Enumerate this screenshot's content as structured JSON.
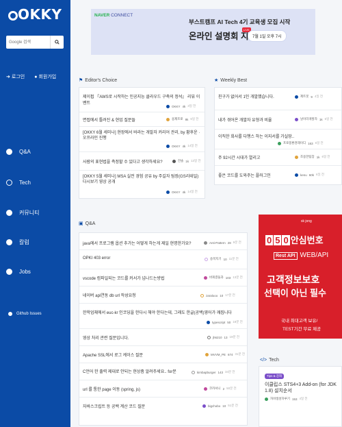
{
  "sidebar": {
    "logo": "OKKY",
    "search_placeholder": "Google 검색",
    "login": "로그인",
    "signup": "회원가입",
    "nav": [
      {
        "label": "Q&A",
        "icon": "qa-icon"
      },
      {
        "label": "Tech",
        "icon": "code-icon"
      },
      {
        "label": "커뮤니티",
        "icon": "community-icon"
      },
      {
        "label": "칼럼",
        "icon": "column-icon"
      },
      {
        "label": "Jobs",
        "icon": "jobs-icon"
      }
    ],
    "github": "Github Issues"
  },
  "banner": {
    "brand_prefix": "NAVER",
    "brand_suffix": " CONNECT",
    "line1": "부스트캠프 AI Tech 4기 교육생 모집 시작",
    "line2": "온라인 설명회 지금 신청!",
    "live": "LIVE",
    "date": "7월 1일 오후 7시"
  },
  "editors_choice": {
    "title": "Editor's Choice",
    "items": [
      {
        "title": "제이펍 『AWS로 시작하는 인공지능 클라우드 구축의 정석』 리뷰 이벤트",
        "author": "OKKY",
        "score": "4k",
        "time": "3일 전"
      },
      {
        "title": "면접에서 틀려진 & 현업 질문들",
        "author": "용제프로",
        "score": "9k",
        "time": "6일 전"
      },
      {
        "title": "[OKKY 6월 세미나] 현장에서 바라는 개발자 커리어 관리, by 황후운 · 오프라인 진행",
        "author": "OKKY",
        "score": "4k",
        "time": "14일 전"
      },
      {
        "title": "사람의 표현법을 측정할 수 있다고 생각하세요?",
        "author": "한솔",
        "score": "1k",
        "time": "13일 전"
      },
      {
        "title": "[OKKY 5월 세미나] MSA 실전 경험 공유 by 주길자 팀장(GS리테일) 다시보기 영상 공개",
        "author": "OKKY",
        "score": "4k",
        "time": "14일 전"
      }
    ]
  },
  "weekly_best": {
    "title": "Weekly Best",
    "items": [
      {
        "title": "친구가 없어서 1인 개발했습니다.",
        "author": "제트봇",
        "score": "9",
        "time": "4일 전"
      },
      {
        "title": "내가 겪어온 개발자 유형과 비율",
        "author": "날아라개발자",
        "score": "1k",
        "time": "6일 전"
      },
      {
        "title": "이직한 회사를 다행스 하는 이지서를 가실땅..",
        "author": "프로퐁환경레이디",
        "score": "163",
        "time": "6일 전"
      },
      {
        "title": "주 92시간 시대가 열리고",
        "author": "조용한팀장",
        "score": "1k",
        "time": "6일 전"
      },
      {
        "title": "좋은 코드를 도와주는 플러그인",
        "author": "kenu",
        "score": "60k",
        "time": "6일 전"
      }
    ]
  },
  "qa": {
    "title": "Q&A",
    "items": [
      {
        "title": "java에서 프로그램 옵션 추가는 어떻게 하는게 제일 현명한가요?",
        "author": "Anti-Pattern",
        "score": "28",
        "time": "9분 전"
      },
      {
        "title": "OPKI 403 error",
        "author": "송목지기",
        "score": "10",
        "time": "11분 전"
      },
      {
        "title": "vscode 컴파일되는 코드를 커서가 넘나드는방법",
        "author": "바꿔결들과",
        "score": "103",
        "time": "13분 전"
      },
      {
        "title": "네이버 api연동 db url 작성요청",
        "author": "zaralooo",
        "score": "10",
        "time": "17분 전"
      },
      {
        "title": "한학업체에서 euc-kr 인코딩을 한다시 해야 한다는데, 그래도 한글(공백)영어가 깨집니다",
        "author": "typescript",
        "score": "50",
        "time": "18분 전"
      },
      {
        "title": "영상 처리 관련 질문입니다.",
        "author": "jh6210",
        "score": "13",
        "time": "19분 전"
      },
      {
        "title": "Apache SSL에서 로그 케이스 질문",
        "author": "MVVM_PE",
        "score": "674",
        "time": "31분 전"
      },
      {
        "title": "C언어 한 출력 제대로 안되는 현상좀 알려주세요.. for문",
        "author": "kimbapburger",
        "score": "143",
        "time": "34분 전"
      },
      {
        "title": "url 를 통한 page 이동 (spring, js)",
        "author": "코카서니",
        "score": "2",
        "time": "50분 전"
      },
      {
        "title": "자바스크립트 등 공백 계산 코드 질문",
        "author": "bigchobo",
        "score": "10",
        "time": "51분 전"
      }
    ]
  },
  "ad": {
    "brand": "sk jong",
    "headline": "안심번호",
    "digits": [
      "0",
      "5",
      "0"
    ],
    "rest": "Rest API",
    "webapi": "WEB/API",
    "line1": "고객정보보호",
    "line2": "선택이 아닌 필수",
    "foot1": "국내 최대고객 보유/",
    "foot2": "TEST기간 무료 제공"
  },
  "tech": {
    "title": "Tech",
    "tag": "Tips & 강좌",
    "item_title": "이클립스 STS4+3 Add-on (for JDK 1.8) 설치순서",
    "author": "자바생성하루기",
    "score": "153",
    "time": "4일 전"
  }
}
